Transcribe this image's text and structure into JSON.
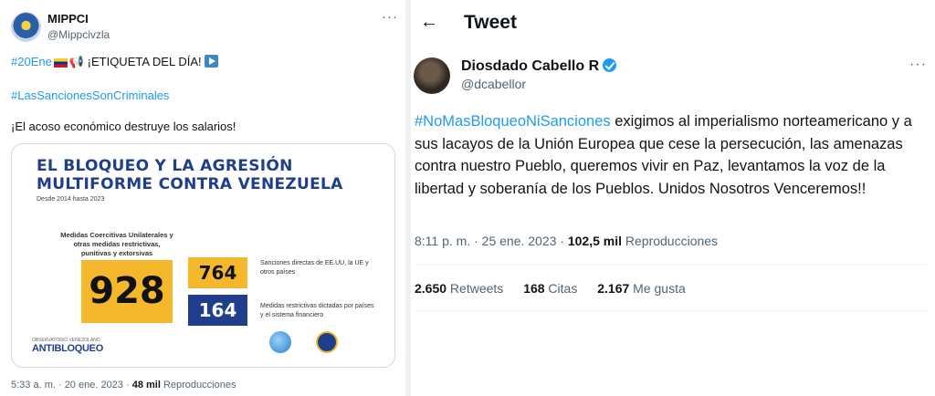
{
  "left_tweet": {
    "author_name": "MIPPCI",
    "author_handle": "@Mippcivzla",
    "more": "···",
    "line1_hashtag": "#20Ene",
    "line1_text": "¡ETIQUETA DEL DÍA!",
    "line1_megaphone": "📢",
    "line2_hashtag": "#LasSancionesSonCriminales",
    "line3_text": "¡El acoso económico destruye los salarios!",
    "card": {
      "title": "EL BLOQUEO Y LA AGRESIÓN MULTIFORME CONTRA VENEZUELA",
      "subtitle": "Desde 2014 hasta 2023",
      "measures_label": "Medidas Coercitivas Unilaterales y otras medidas restrictivas, punitivas y extorsivas",
      "total": "928",
      "direct": "764",
      "direct_note": "Sanciones directas de EE.UU, la UE y otros países",
      "restrictive": "164",
      "restrictive_note": "Medidas restrictivas dictadas por países y el sistema financiero",
      "logo_small": "OBSERVATORIO VENEZOLANO",
      "logo": "ANTIBLOQUEO"
    },
    "meta_time": "5:33 a. m. · 20 ene. 2023 · ",
    "meta_views": "48 mil",
    "meta_views_label": " Reproducciones"
  },
  "right_tweet": {
    "back_icon": "←",
    "header": "Tweet",
    "author_name": "Diosdado Cabello R",
    "author_handle": "@dcabellor",
    "more": "···",
    "hashtag": "#NoMasBloqueoNiSanciones",
    "text": " exigimos al imperialismo norteamericano y a sus lacayos de la Unión Europea que cese la persecución, las amenazas contra nuestro Pueblo, queremos vivir en Paz, levantamos la voz de la libertad y soberanía de los Pueblos. Unidos Nosotros Venceremos!!",
    "meta_time": "8:11 p. m. · 25 ene. 2023 · ",
    "meta_views": "102,5 mil",
    "meta_views_label": " Reproducciones",
    "retweets": "2.650",
    "retweets_label": " Retweets",
    "quotes": "168",
    "quotes_label": " Citas",
    "likes": "2.167",
    "likes_label": " Me gusta"
  },
  "colors": {
    "link": "#1d9bf0",
    "muted": "#536471",
    "navy": "#1f3f8c",
    "gold": "#f5b72c"
  }
}
